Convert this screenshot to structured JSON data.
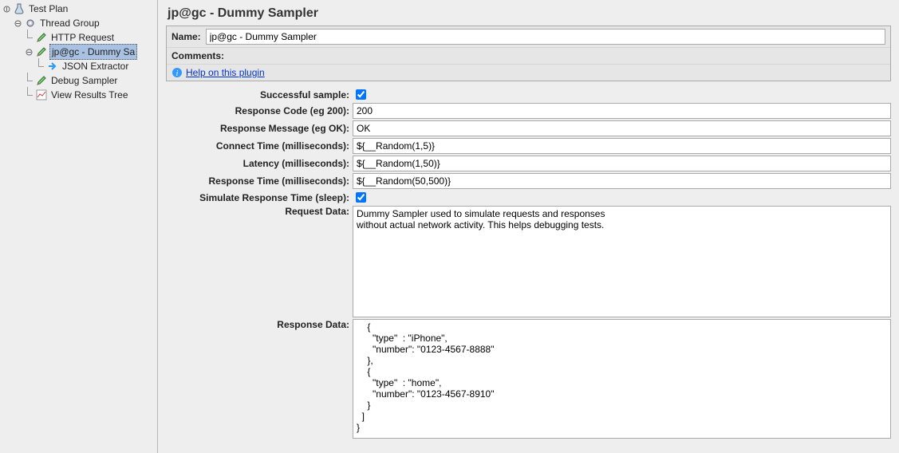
{
  "tree": {
    "root": {
      "label": "Test Plan",
      "icon": "flask"
    },
    "items": [
      {
        "label": "Thread Group",
        "icon": "gear",
        "depth": 1,
        "expanded": true
      },
      {
        "label": "HTTP Request",
        "icon": "pencil",
        "depth": 2,
        "leaf": true
      },
      {
        "label": "jp@gc - Dummy Sa",
        "icon": "pencil",
        "depth": 2,
        "expanded": true,
        "selected": true
      },
      {
        "label": "JSON Extractor",
        "icon": "arrow",
        "depth": 3,
        "leaf": true
      },
      {
        "label": "Debug Sampler",
        "icon": "pencil",
        "depth": 2,
        "leaf": true
      },
      {
        "label": "View Results Tree",
        "icon": "chart",
        "depth": 2,
        "leaf": true
      }
    ]
  },
  "panel": {
    "title": "jp@gc - Dummy Sampler",
    "name_label": "Name:",
    "name_value": "jp@gc - Dummy Sampler",
    "comments_label": "Comments:",
    "help_link": "Help on this plugin",
    "fields": {
      "successful_sample": {
        "label": "Successful sample:",
        "checked": true
      },
      "response_code": {
        "label": "Response Code (eg 200):",
        "value": "200"
      },
      "response_message": {
        "label": "Response Message (eg OK):",
        "value": "OK"
      },
      "connect_time": {
        "label": "Connect Time (milliseconds):",
        "value": "${__Random(1,5)}"
      },
      "latency": {
        "label": "Latency (milliseconds):",
        "value": "${__Random(1,50)}"
      },
      "response_time": {
        "label": "Response Time (milliseconds):",
        "value": "${__Random(50,500)}"
      },
      "simulate_sleep": {
        "label": "Simulate Response Time (sleep):",
        "checked": true
      },
      "request_data": {
        "label": "Request Data:",
        "value": "Dummy Sampler used to simulate requests and responses\nwithout actual network activity. This helps debugging tests."
      },
      "response_data": {
        "label": "Response Data:",
        "value": "    {\n      \"type\"  : \"iPhone\",\n      \"number\": \"0123-4567-8888\"\n    },\n    {\n      \"type\"  : \"home\",\n      \"number\": \"0123-4567-8910\"\n    }\n  ]\n}"
      }
    }
  }
}
